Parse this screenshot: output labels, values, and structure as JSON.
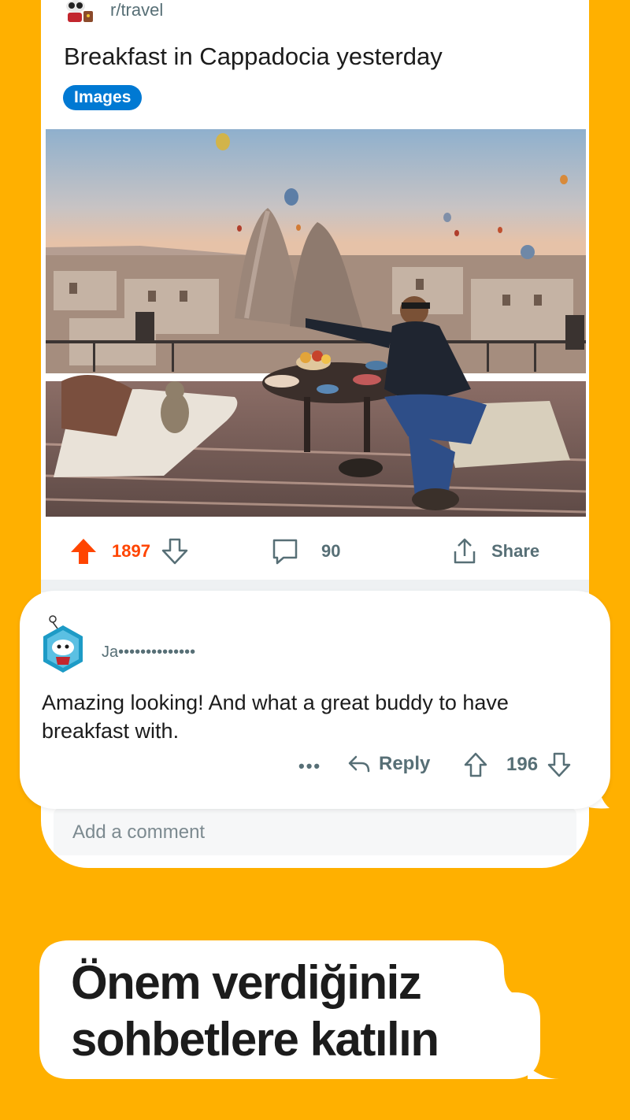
{
  "post": {
    "subreddit": "r/travel",
    "title": "Breakfast in Cappadocia yesterday",
    "flair": "Images",
    "upvotes": "1897",
    "comments": "90",
    "share_label": "Share",
    "add_comment_placeholder": "Add a comment"
  },
  "comment": {
    "username": "Ja••••••••••••••",
    "body": "Amazing looking! And what a great buddy to have breakfast with.",
    "more_label": "•••",
    "reply_label": "Reply",
    "votes": "196"
  },
  "promo": {
    "line1": "Önem verdiğiniz",
    "line2": "sohbetlere katılın"
  },
  "colors": {
    "background": "#FFB000",
    "upvote_active": "#FF4500",
    "flair": "#0079D3",
    "muted_text": "#576F76"
  },
  "icons": [
    "upvote-icon",
    "downvote-icon",
    "comment-icon",
    "share-icon",
    "reply-icon",
    "more-icon"
  ]
}
